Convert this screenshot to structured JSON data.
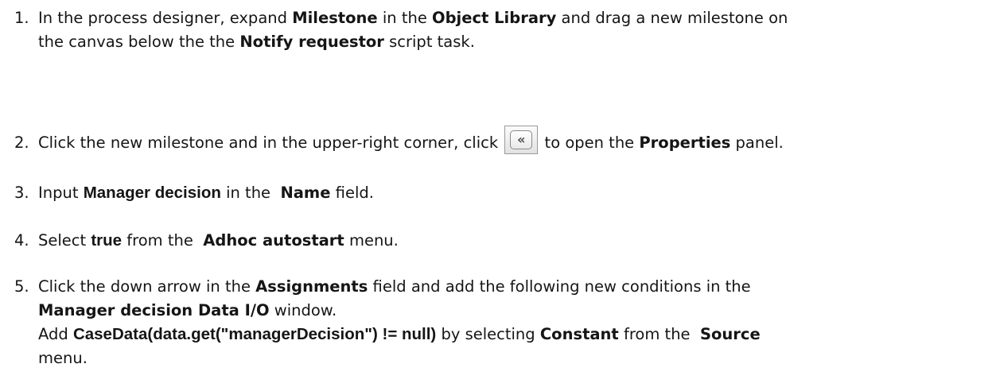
{
  "steps": [
    {
      "number": "1.",
      "line1": {
        "t1": "In the process designer, expand ",
        "b1": "Milestone",
        "t2": " in the ",
        "b2": "Object Library",
        "t3": " and drag a new milestone on"
      },
      "line2": {
        "t1": "the canvas below the the ",
        "b1": "Notify requestor",
        "t2": " script task."
      }
    },
    {
      "number": "2.",
      "t1": "Click the new milestone and in the upper-right corner, click ",
      "icon_glyph": "«",
      "icon": "collapse-panel-icon",
      "t2": " to open the ",
      "b1": "Properties",
      "t3": " panel."
    },
    {
      "number": "3.",
      "t1": "Input ",
      "b1": "Manager decision",
      "t2": " in the  ",
      "b2": "Name",
      "t3": " field."
    },
    {
      "number": "4.",
      "t1": "Select ",
      "b1": "true",
      "t2": " from the  ",
      "b2": "Adhoc autostart",
      "t3": " menu."
    },
    {
      "number": "5.",
      "line1": {
        "t1": "Click the down arrow in the ",
        "b1": "Assignments",
        "t2": " field and add the following new conditions in the"
      },
      "line2": {
        "b1": "Manager decision Data I/O",
        "t1": " window."
      },
      "line3": {
        "t1": "Add ",
        "b1": "CaseData(data.get(\"managerDecision\") != null)",
        "t2": " by selecting ",
        "b2": "Constant",
        "t3": " from the  ",
        "b3": "Source"
      },
      "line4": {
        "t1": "menu."
      }
    }
  ]
}
